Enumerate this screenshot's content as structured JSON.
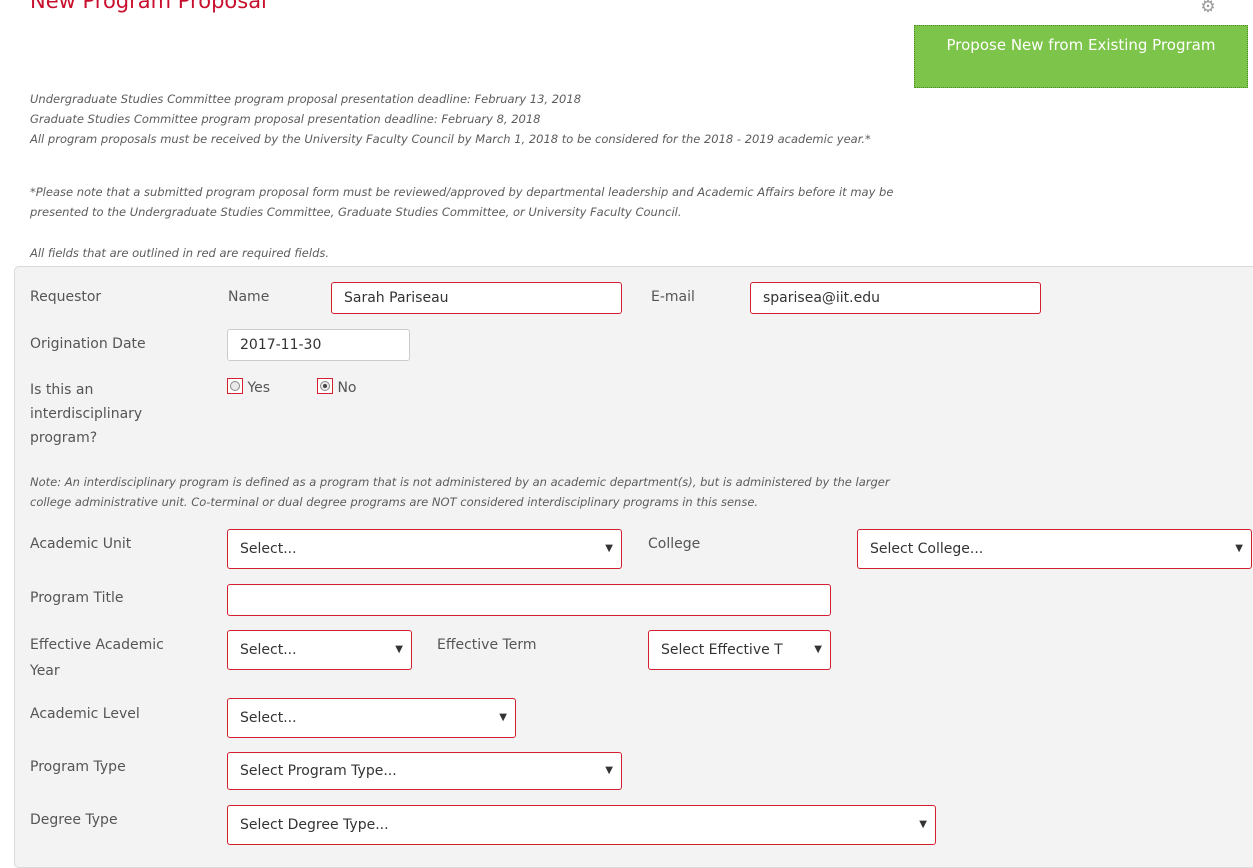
{
  "page": {
    "title": "New Program Proposal"
  },
  "actions": {
    "propose_existing_label": "Propose New from Existing Program",
    "gear_icon": "gear-icon"
  },
  "notes": {
    "ugsc_deadline": "Undergraduate Studies Committee program proposal presentation deadline: February 13, 2018",
    "gsc_deadline": "Graduate Studies Committee program proposal presentation deadline: February 8, 2018",
    "ufc_deadline": "All program proposals must be received by the University Faculty Council by March 1, 2018 to be considered for the 2018 - 2019 academic year.*",
    "review_line1": "*Please note that a submitted program proposal form must be reviewed/approved by departmental leadership and Academic Affairs before it may be",
    "review_line2": "presented to the Undergraduate Studies Committee, Graduate Studies Committee, or University Faculty Council.",
    "required_note": "All fields that are outlined in red are required fields."
  },
  "form": {
    "requestor_label": "Requestor",
    "name_label": "Name",
    "name_value": "Sarah Pariseau",
    "email_label": "E-mail",
    "email_value": "sparisea@iit.edu",
    "origination_label": "Origination Date",
    "origination_value": "2017-11-30",
    "interdisc_label_1": "Is this an",
    "interdisc_label_2": "interdisciplinary",
    "interdisc_label_3": "program?",
    "yes_label": "Yes",
    "no_label": "No",
    "interdisc_selected": "No",
    "interdisc_note_1": "Note: An interdisciplinary program is defined as a program that is not administered by an academic department(s), but is administered by the larger",
    "interdisc_note_2": "college administrative unit. Co-terminal or dual degree programs are NOT considered interdisciplinary programs in this sense.",
    "academic_unit_label": "Academic Unit",
    "academic_unit_value": "Select...",
    "college_label": "College",
    "college_value": "Select College...",
    "program_title_label": "Program Title",
    "program_title_value": "",
    "eff_year_label_1": "Effective Academic",
    "eff_year_label_2": "Year",
    "eff_year_value": "Select...",
    "eff_term_label": "Effective Term",
    "eff_term_value": "Select Effective T",
    "academic_level_label": "Academic Level",
    "academic_level_value": "Select...",
    "program_type_label": "Program Type",
    "program_type_value": "Select Program Type...",
    "degree_type_label": "Degree Type",
    "degree_type_value": "Select Degree Type..."
  },
  "colors": {
    "accent_red": "#c8102e",
    "button_green": "#7dc44a",
    "panel_bg": "#f3f3f3"
  }
}
